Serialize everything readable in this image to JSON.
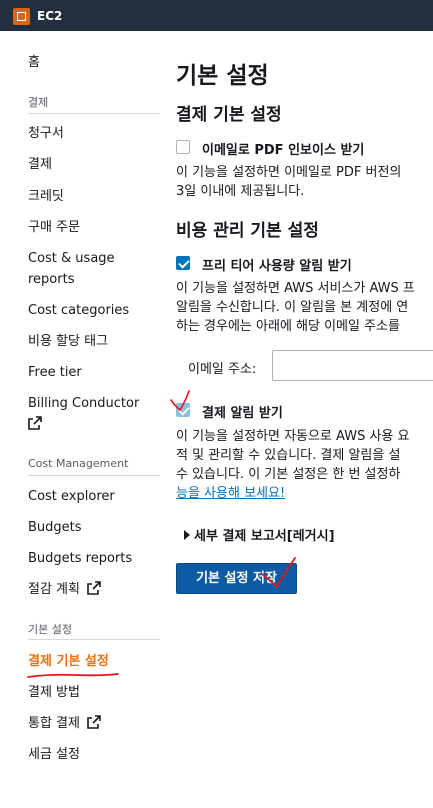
{
  "header": {
    "app_name": "EC2"
  },
  "sidebar": {
    "home": "홈",
    "billing_section": "결제",
    "billing_items": [
      "청구서",
      "결제",
      "크레딧",
      "구매 주문",
      "Cost & usage",
      "reports",
      "Cost categories",
      "비용 할당 태그",
      "Free tier",
      "Billing Conductor"
    ],
    "cost_section": "Cost Management",
    "cost_items": [
      "Cost explorer",
      "Budgets",
      "Budgets reports",
      "절감 계획"
    ],
    "prefs_section": "기본 설정",
    "prefs_items": [
      "결제 기본 설정",
      "결제 방법",
      "통합 결제",
      "세금 설정"
    ],
    "active_item": "결제 기본 설정"
  },
  "main": {
    "title": "기본 설정",
    "billing_prefs_heading": "결제 기본 설정",
    "pdf_invoice": {
      "label": "이메일로 PDF 인보이스 받기",
      "checked": false,
      "desc": [
        "이 기능을 설정하면 이메일로 PDF 버전의",
        "3일 이내에 제공됩니다."
      ]
    },
    "cost_prefs_heading": "비용 관리 기본 설정",
    "free_tier_alert": {
      "label": "프리 티어 사용량 알림 받기",
      "checked": true,
      "desc": [
        "이 기능을 설정하면 AWS 서비스가 AWS 프",
        "알림을 수신합니다. 이 알림을 본 계정에 연",
        "하는 경우에는 아래에 해당 이메일 주소를"
      ]
    },
    "email": {
      "label": "이메일 주소:",
      "value": "",
      "placeholder": ""
    },
    "billing_alert": {
      "label": "결제 알림 받기",
      "checked": true,
      "desc": [
        "이 기능을 설정하면 자동으로 AWS 사용 요",
        "적 및 관리할 수 있습니다. 결제 알림을 설",
        "수 있습니다. 이 기본 설정은 한 번 설정하"
      ],
      "link": "능을 사용해 보세요!"
    },
    "detailed_reports": "세부 결제 보고서[레거시]",
    "save_button": "기본 설정 저장"
  },
  "colors": {
    "topbar": "#232f3e",
    "accent": "#0073bb",
    "active_nav": "#ec7211",
    "button": "#0e5ba3",
    "annotation": "#e8131b"
  }
}
